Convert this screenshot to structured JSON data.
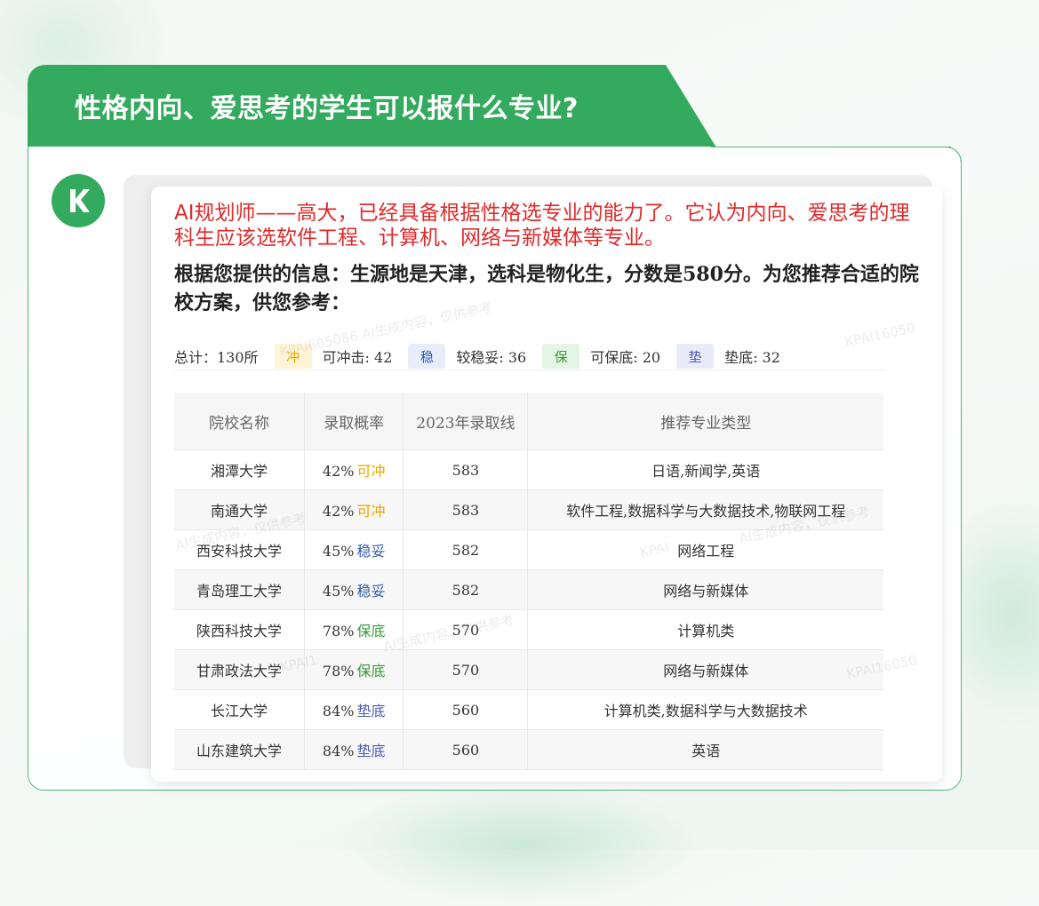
{
  "header": {
    "title": "性格内向、爱思考的学生可以报什么专业?"
  },
  "logo": {
    "icon": "k-logo-icon",
    "letter": "K"
  },
  "colors": {
    "brand_green": "#34aa5f",
    "intro_red": "#e02a2a",
    "chong": "#e8a800",
    "wen": "#2f5ea8",
    "bao": "#3a9a3a",
    "dian": "#4a5bb0"
  },
  "answer": {
    "intro": "AI规划师——高大，已经具备根据性格选专业的能力了。它认为内向、爱思考的理科生应该选软件工程、计算机、网络与新媒体等专业。",
    "body": "根据您提供的信息：生源地是天津，选科是物化生，分数是580分。为您推荐合适的院校方案，供您参考："
  },
  "summary": {
    "total": "总计：130所",
    "tags": [
      {
        "badge": "冲",
        "label": "可冲击: 42"
      },
      {
        "badge": "稳",
        "label": "较稳妥: 36"
      },
      {
        "badge": "保",
        "label": "可保底: 20"
      },
      {
        "badge": "垫",
        "label": "垫底: 32"
      }
    ]
  },
  "table": {
    "headers": [
      "院校名称",
      "录取概率",
      "2023年录取线",
      "推荐专业类型"
    ],
    "rows": [
      {
        "school": "湘潭大学",
        "prob": "42%",
        "level": "可冲",
        "score": "583",
        "majors": "日语,新闻学,英语"
      },
      {
        "school": "南通大学",
        "prob": "42%",
        "level": "可冲",
        "score": "583",
        "majors": "软件工程,数据科学与大数据技术,物联网工程"
      },
      {
        "school": "西安科技大学",
        "prob": "45%",
        "level": "稳妥",
        "score": "582",
        "majors": "网络工程"
      },
      {
        "school": "青岛理工大学",
        "prob": "45%",
        "level": "稳妥",
        "score": "582",
        "majors": "网络与新媒体"
      },
      {
        "school": "陕西科技大学",
        "prob": "78%",
        "level": "保底",
        "score": "570",
        "majors": "计算机类"
      },
      {
        "school": "甘肃政法大学",
        "prob": "78%",
        "level": "保底",
        "score": "570",
        "majors": "网络与新媒体"
      },
      {
        "school": "长江大学",
        "prob": "84%",
        "level": "垫底",
        "score": "560",
        "majors": "计算机类,数据科学与大数据技术"
      },
      {
        "school": "山东建筑大学",
        "prob": "84%",
        "level": "垫底",
        "score": "560",
        "majors": "英语"
      }
    ]
  },
  "watermarks": {
    "code_a": "KPAI605086",
    "code_b": "KPAI16050",
    "code_c": "KPAI",
    "code_d": "KPAI1",
    "text": "AI生成内容，仅供参考"
  }
}
